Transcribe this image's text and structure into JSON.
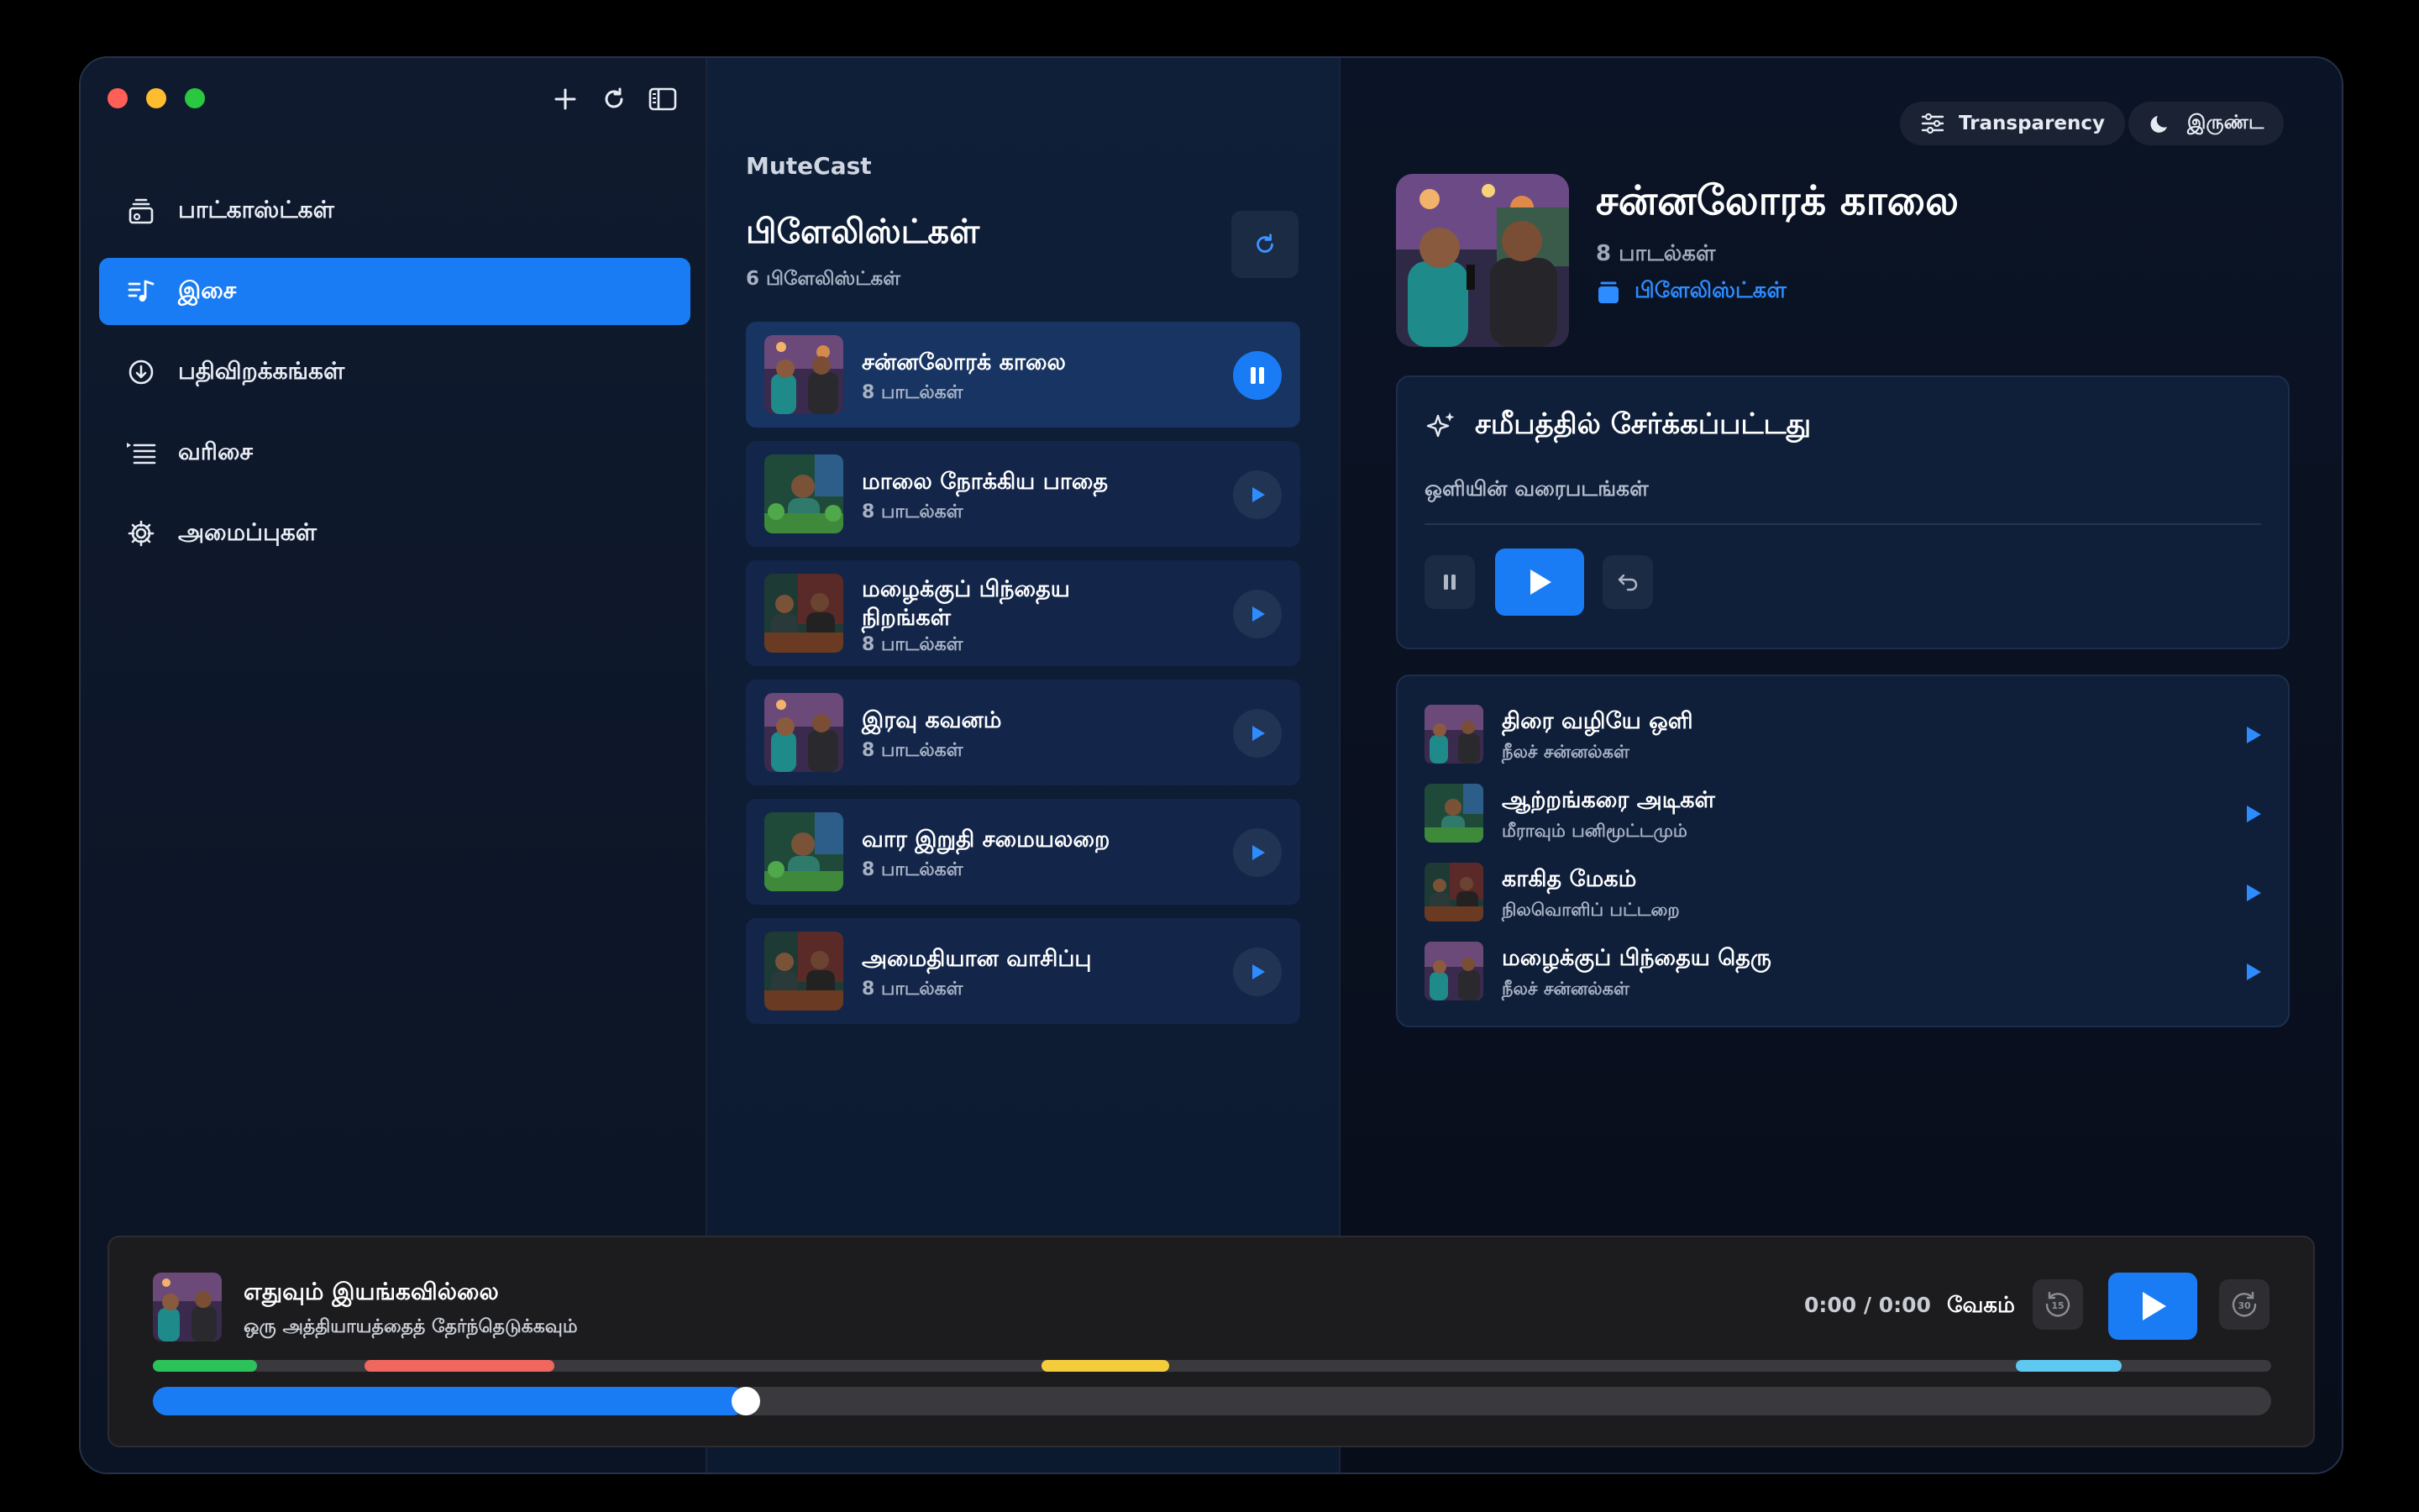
{
  "sidebar": {
    "items": [
      {
        "label": "பாட்காஸ்ட்கள்",
        "icon": "podcast-stack-icon"
      },
      {
        "label": "இசை",
        "icon": "music-list-icon",
        "active": true
      },
      {
        "label": "பதிவிறக்கங்கள்",
        "icon": "download-circle-icon"
      },
      {
        "label": "வரிசை",
        "icon": "queue-list-icon"
      },
      {
        "label": "அமைப்புகள்",
        "icon": "gear-icon"
      }
    ]
  },
  "playlists": {
    "brand": "MuteCast",
    "title": "பிளேலிஸ்ட்கள்",
    "count": "6 பிளேலிஸ்ட்கள்",
    "items": [
      {
        "name": "சன்னலோரக் காலை",
        "count": "8 பாடல்கள்",
        "playing": true
      },
      {
        "name": "மாலை நோக்கிய பாதை",
        "count": "8 பாடல்கள்"
      },
      {
        "name": "மழைக்குப் பிந்தைய நிறங்கள்",
        "count": "8 பாடல்கள்"
      },
      {
        "name": "இரவு கவனம்",
        "count": "8 பாடல்கள்"
      },
      {
        "name": "வார இறுதி சமையலறை",
        "count": "8 பாடல்கள்"
      },
      {
        "name": "அமைதியான வாசிப்பு",
        "count": "8 பாடல்கள்"
      }
    ]
  },
  "detail": {
    "transparency_label": "Transparency",
    "theme_label": "இருண்ட",
    "title": "சன்னலோரக் காலை",
    "subtitle": "8 பாடல்கள்",
    "link": "பிளேலிஸ்ட்கள்",
    "recent": {
      "title": "சமீபத்தில் சேர்க்கப்பட்டது",
      "subtitle": "ஒளியின் வரைபடங்கள்"
    },
    "tracks": [
      {
        "name": "திரை வழியே ஒளி",
        "artist": "நீலச் சன்னல்கள்"
      },
      {
        "name": "ஆற்றங்கரை அடிகள்",
        "artist": "மீராவும் பனிமூட்டமும்"
      },
      {
        "name": "காகித மேகம்",
        "artist": "நிலவொளிப் பட்டறை"
      },
      {
        "name": "மழைக்குப் பிந்தைய தெரு",
        "artist": "நீலச் சன்னல்கள்"
      }
    ]
  },
  "player": {
    "title": "எதுவும் இயங்கவில்லை",
    "subtitle": "ஒரு அத்தியாயத்தைத் தேர்ந்தெடுக்கவும்",
    "time": "0:00 / 0:00",
    "speed_label": "வேகம்",
    "skip_back": "15",
    "skip_forward": "30",
    "progress": 0.28,
    "chapter_colors": [
      "#2bc25a",
      "#f0675f",
      "#f5cc3c",
      "#5ec8f0"
    ]
  },
  "colors": {
    "accent": "#1a7cf5",
    "link": "#2d8cff"
  }
}
